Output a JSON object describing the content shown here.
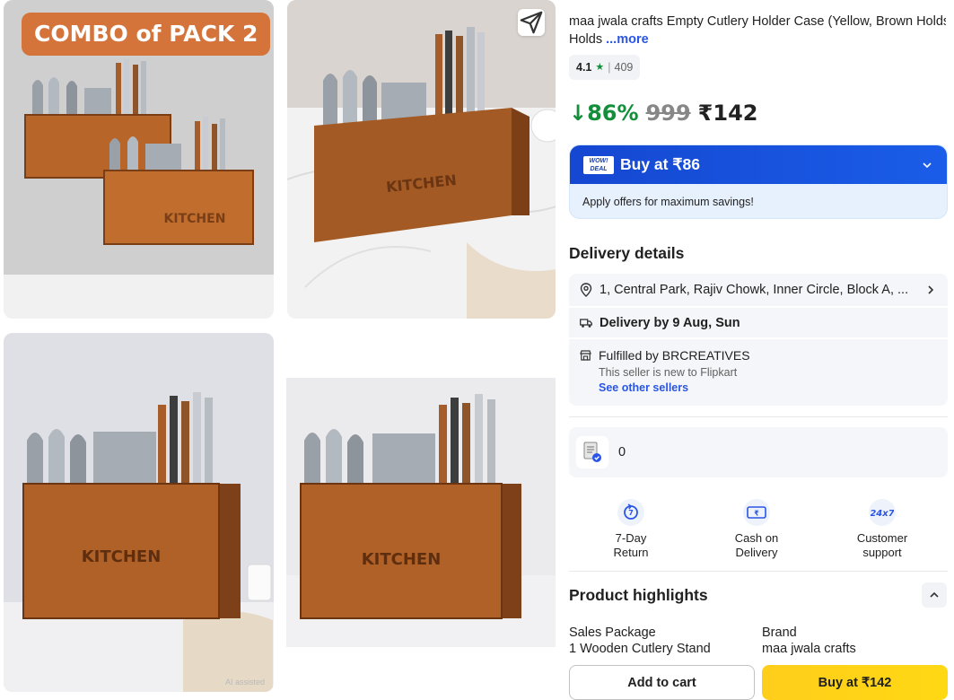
{
  "gallery": {
    "combo_badge": "COMBO of PACK 2",
    "box_label": "KITCHEN",
    "ai_tag": "AI assisted"
  },
  "product": {
    "title": "maa jwala crafts Empty Cutlery Holder Case (Yellow, Brown Holds",
    "title_line2": "Holds",
    "more_label": "...more",
    "rating": "4.1",
    "rating_star": "★",
    "rating_sep": "|",
    "rating_count": "409",
    "discount": "↓86%",
    "mrp": "999",
    "price": "₹142"
  },
  "deal": {
    "wow_badge": "WOW! DEAL",
    "buy_label": "Buy at ₹86",
    "sub_text": "Apply offers for maximum savings!"
  },
  "delivery": {
    "heading": "Delivery details",
    "address": "1, Central Park, Rajiv Chowk, Inner Circle, Block A, ...",
    "delivery_date": "Delivery by 9 Aug, Sun",
    "fulfilled_by": "Fulfilled by BRCREATIVES",
    "seller_note": "This seller is new to Flipkart",
    "other_sellers": "See other sellers"
  },
  "inventory": {
    "count": "0"
  },
  "features": [
    {
      "icon": "return-icon",
      "line1": "7-Day",
      "line2": "Return"
    },
    {
      "icon": "cash-icon",
      "line1": "Cash on",
      "line2": "Delivery"
    },
    {
      "icon": "support-24x7-icon",
      "line1": "Customer",
      "line2": "support"
    }
  ],
  "highlights": {
    "heading": "Product highlights",
    "items": [
      {
        "label": "Sales Package",
        "value": "1 Wooden Cutlery Stand"
      },
      {
        "label": "Brand",
        "value": "maa jwala crafts"
      }
    ]
  },
  "actions": {
    "add_to_cart": "Add to cart",
    "buy_now": "Buy at ₹142"
  },
  "colors": {
    "discount_green": "#138f3a",
    "link_blue": "#2a55e5",
    "deal_blue": "#1547d1",
    "buy_yellow": "#ffd814",
    "wood": "#b8652a"
  }
}
